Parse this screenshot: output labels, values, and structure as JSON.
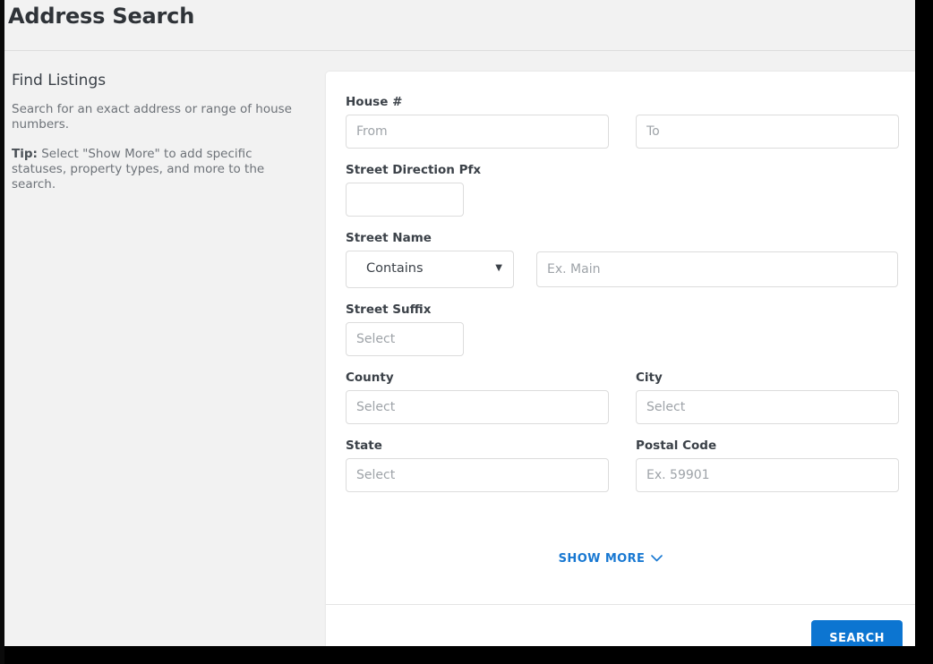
{
  "header": {
    "title": "Address Search"
  },
  "sidebar": {
    "heading": "Find Listings",
    "description": "Search for an exact address or range of house numbers.",
    "tip_label": "Tip:",
    "tip_text": " Select \"Show More\" to add specific statuses, property types, and more to the search."
  },
  "form": {
    "house_number": {
      "label": "House #",
      "from_placeholder": "From",
      "from_value": "",
      "to_placeholder": "To",
      "to_value": ""
    },
    "street_direction_pfx": {
      "label": "Street Direction Pfx",
      "placeholder": "",
      "value": ""
    },
    "street_name": {
      "label": "Street Name",
      "match_selected": "Contains",
      "match_options": [
        "Contains"
      ],
      "arrow_icon": "▼",
      "placeholder": "Ex. Main",
      "value": ""
    },
    "street_suffix": {
      "label": "Street Suffix",
      "placeholder": "Select",
      "value": ""
    },
    "county": {
      "label": "County",
      "placeholder": "Select",
      "value": ""
    },
    "city": {
      "label": "City",
      "placeholder": "Select",
      "value": ""
    },
    "state": {
      "label": "State",
      "placeholder": "Select",
      "value": ""
    },
    "postal_code": {
      "label": "Postal Code",
      "placeholder": "Ex. 59901",
      "value": ""
    }
  },
  "actions": {
    "show_more_label": "SHOW MORE",
    "show_more_icon": "⌄",
    "search_label": "SEARCH"
  },
  "colors": {
    "accent_blue": "#0c75d1",
    "link_blue": "#1878d2",
    "panel_bg": "#f2f2f2",
    "card_bg": "#ffffff",
    "border": "#dcdcdc",
    "label_text": "#3b4148",
    "muted_text": "#6d7278",
    "placeholder_text": "#9ea3a8"
  }
}
